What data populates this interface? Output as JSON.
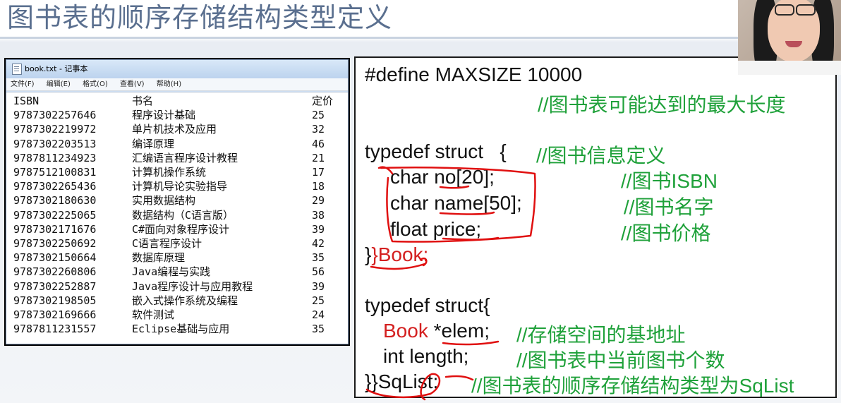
{
  "slide": {
    "title": "图书表的顺序存储结构类型定义"
  },
  "notepad": {
    "window_title": "book.txt - 记事本",
    "menu": [
      "文件(F)",
      "编辑(E)",
      "格式(O)",
      "查看(V)",
      "帮助(H)"
    ],
    "headers": [
      "ISBN",
      "书名",
      "定价"
    ],
    "rows": [
      [
        "9787302257646",
        "程序设计基础",
        "25"
      ],
      [
        "9787302219972",
        "单片机技术及应用",
        "32"
      ],
      [
        "9787302203513",
        "编译原理",
        "46"
      ],
      [
        "9787811234923",
        "汇编语言程序设计教程",
        "21"
      ],
      [
        "9787512100831",
        "计算机操作系统",
        "17"
      ],
      [
        "9787302265436",
        "计算机导论实验指导",
        "18"
      ],
      [
        "9787302180630",
        "实用数据结构",
        "29"
      ],
      [
        "9787302225065",
        "数据结构（C语言版）",
        "38"
      ],
      [
        "9787302171676",
        "C#面向对象程序设计",
        "39"
      ],
      [
        "9787302250692",
        "C语言程序设计",
        "42"
      ],
      [
        "9787302150664",
        "数据库原理",
        "35"
      ],
      [
        "9787302260806",
        "Java编程与实践",
        "56"
      ],
      [
        "9787302252887",
        "Java程序设计与应用教程",
        "39"
      ],
      [
        "9787302198505",
        "嵌入式操作系统及编程",
        "25"
      ],
      [
        "9787302169666",
        "软件测试",
        "24"
      ],
      [
        "9787811231557",
        "Eclipse基础与应用",
        "35"
      ]
    ]
  },
  "code": {
    "l1": "#define MAXSIZE 10000",
    "l1_comment": "//图书表可能达到的最大长度",
    "l2": "typedef struct   {",
    "l2_comment": "//图书信息定义",
    "l3": "char no[20];",
    "l3_comment": "//图书ISBN",
    "l4": "char name[50];",
    "l4_comment": "//图书名字",
    "l5": "float price;",
    "l5_comment": "//图书价格",
    "l6": "}Book;",
    "l7": "typedef struct{",
    "l8a": "Book",
    "l8b": "*elem;",
    "l8_comment": "//存储空间的基地址",
    "l9": "int length;",
    "l9_comment": "//图书表中当前图书个数",
    "l10": "}SqList;",
    "l10_comment": "//图书表的顺序存储结构类型为SqList"
  },
  "colors": {
    "title": "#5a6f8f",
    "comment": "#1fa13a",
    "keyword_red": "#d42020",
    "annotation": "#e01010"
  }
}
